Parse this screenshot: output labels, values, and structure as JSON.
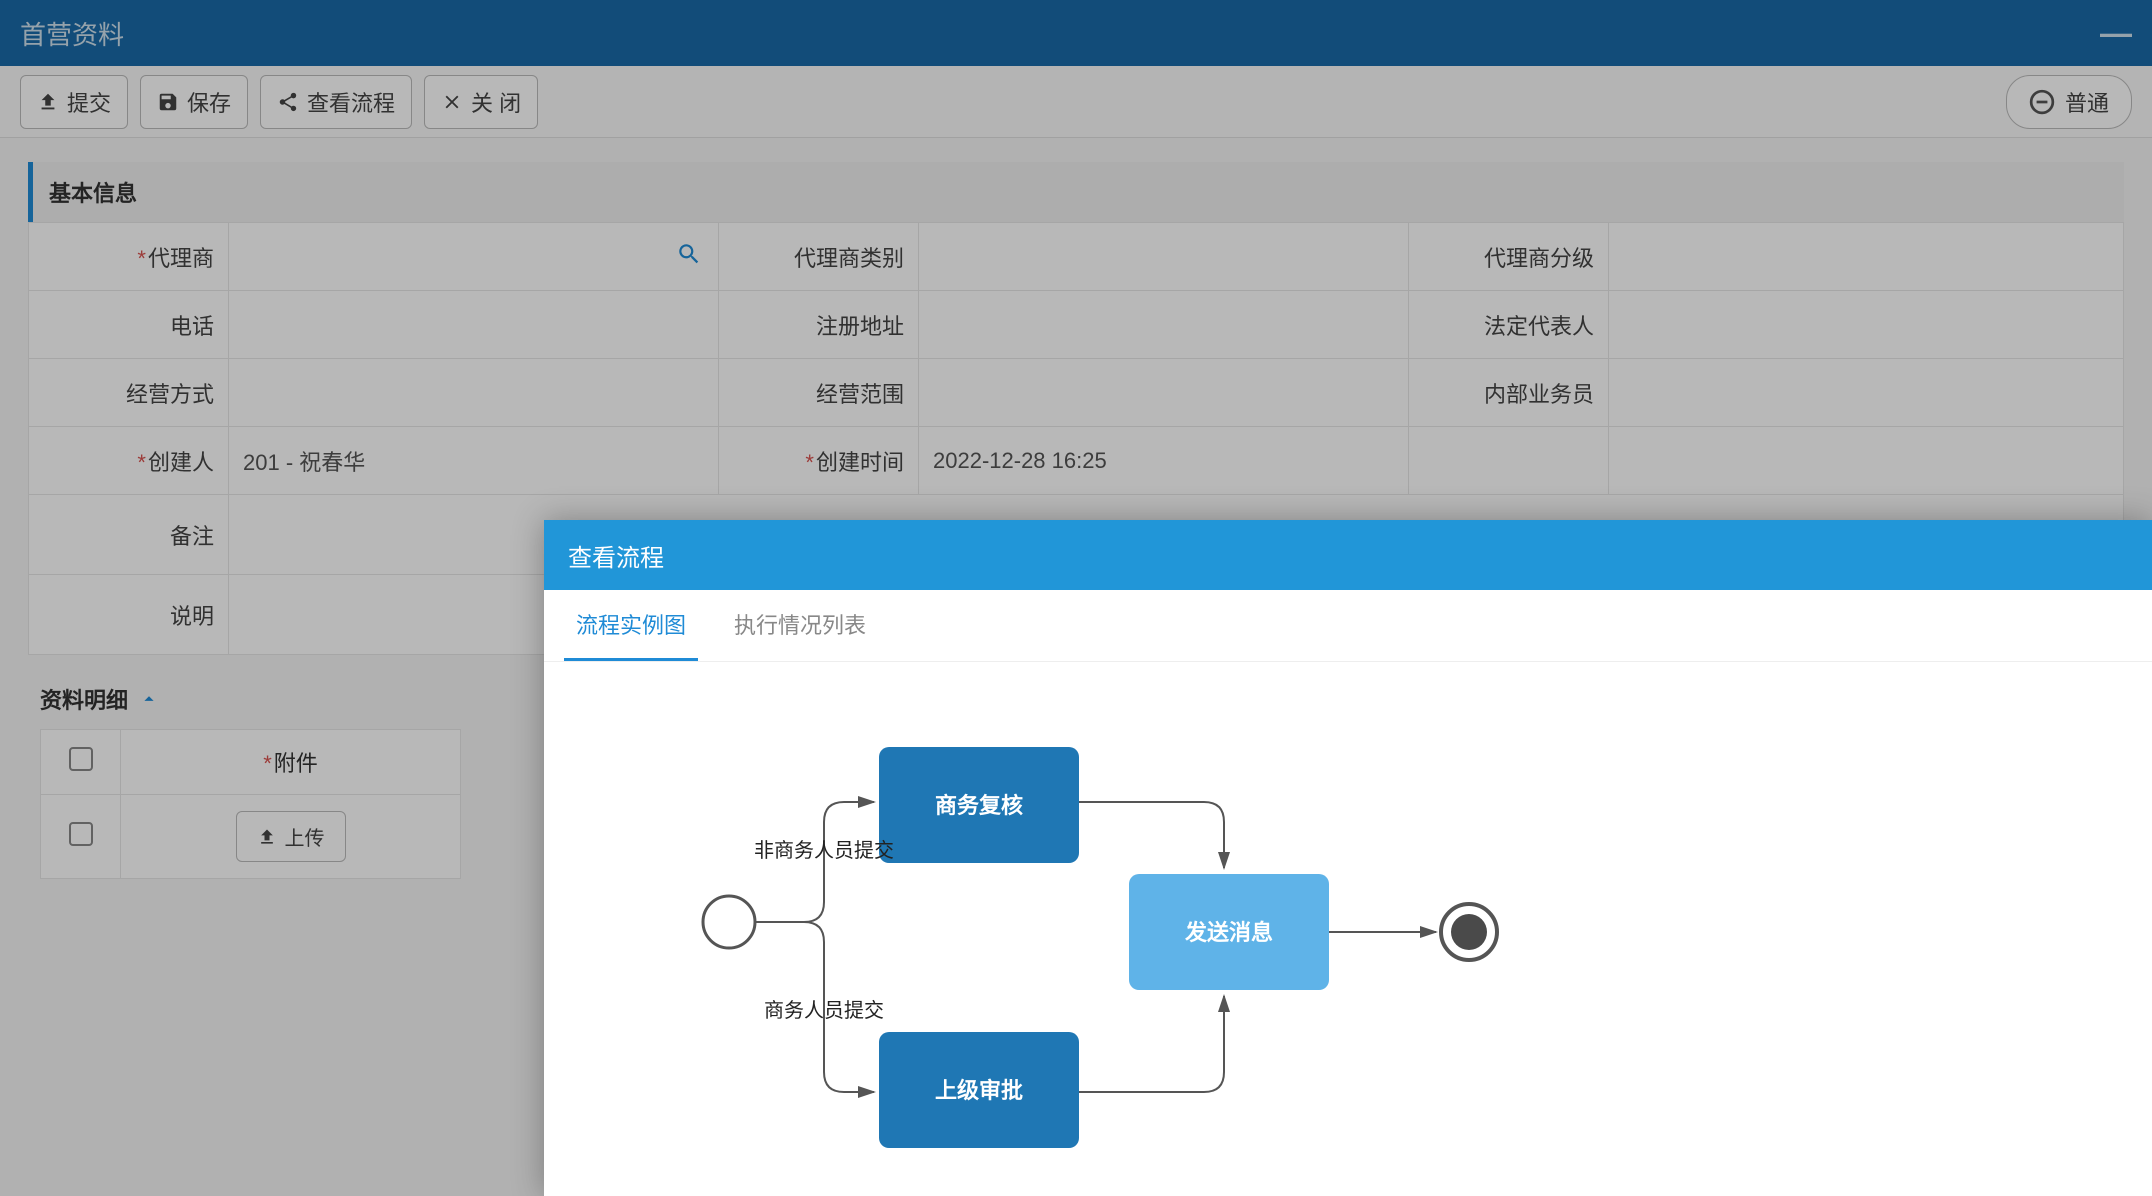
{
  "header": {
    "title": "首营资料"
  },
  "toolbar": {
    "submit": "提交",
    "save": "保存",
    "view_flow": "查看流程",
    "close": "关 闭",
    "status": "普通"
  },
  "section_basic": {
    "title": "基本信息",
    "fields": {
      "agent": "代理商",
      "agent_category": "代理商类别",
      "agent_grade": "代理商分级",
      "phone": "电话",
      "reg_address": "注册地址",
      "legal_rep": "法定代表人",
      "business_mode": "经营方式",
      "business_scope": "经营范围",
      "internal_sales": "内部业务员",
      "creator": "创建人",
      "create_time": "创建时间",
      "remark": "备注",
      "description": "说明"
    },
    "values": {
      "creator": "201 - 祝春华",
      "create_time": "2022-12-28 16:25"
    }
  },
  "section_detail": {
    "title": "资料明细",
    "columns": {
      "attachment": "附件"
    },
    "upload_label": "上传"
  },
  "dialog": {
    "title": "查看流程",
    "tabs": {
      "diagram": "流程实例图",
      "list": "执行情况列表"
    }
  },
  "chart_data": {
    "type": "flowchart",
    "nodes": [
      {
        "id": "start",
        "kind": "start"
      },
      {
        "id": "n1",
        "kind": "task",
        "label": "商务复核"
      },
      {
        "id": "n2",
        "kind": "task",
        "label": "上级审批"
      },
      {
        "id": "n3",
        "kind": "task-light",
        "label": "发送消息"
      },
      {
        "id": "end",
        "kind": "end"
      }
    ],
    "edges": [
      {
        "from": "start",
        "to": "n1",
        "label": "非商务人员提交"
      },
      {
        "from": "start",
        "to": "n2",
        "label": "商务人员提交"
      },
      {
        "from": "n1",
        "to": "n3"
      },
      {
        "from": "n2",
        "to": "n3"
      },
      {
        "from": "n3",
        "to": "end"
      }
    ]
  }
}
